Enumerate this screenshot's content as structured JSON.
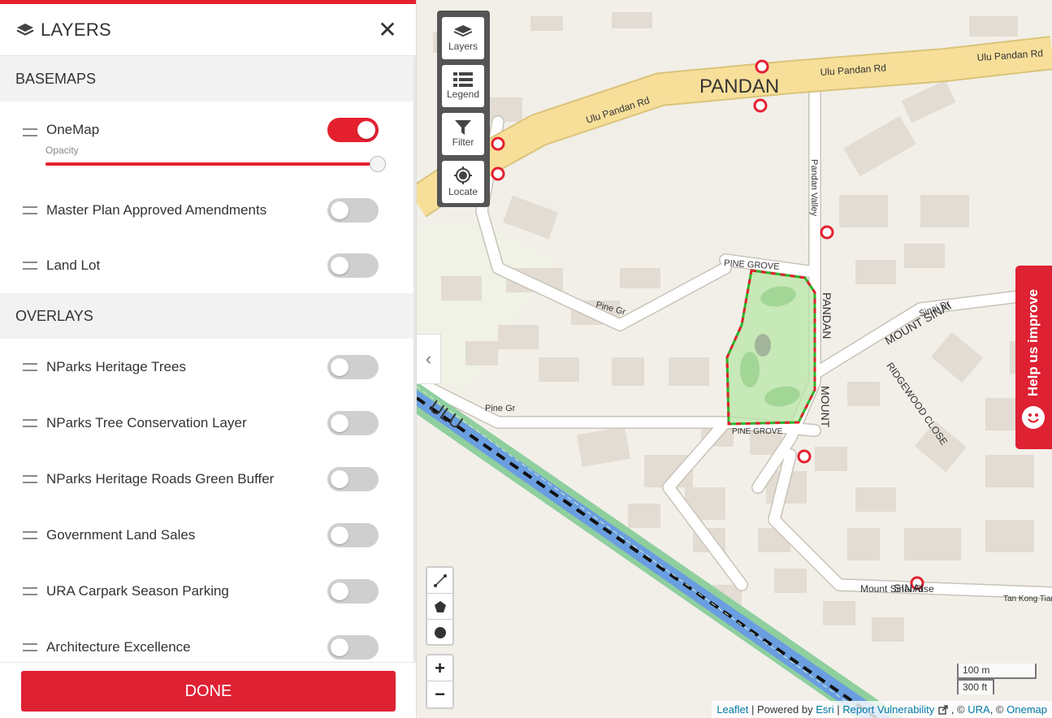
{
  "panel": {
    "title": "LAYERS",
    "close_glyph": "✕",
    "basemaps": {
      "heading": "BASEMAPS",
      "items": [
        {
          "label": "OneMap",
          "enabled": true,
          "opacity_label": "Opacity",
          "opacity": 1.0
        },
        {
          "label": "Master Plan Approved Amendments",
          "enabled": false
        },
        {
          "label": "Land Lot",
          "enabled": false
        }
      ]
    },
    "overlays": {
      "heading": "OVERLAYS",
      "items": [
        {
          "label": "NParks Heritage Trees",
          "enabled": false
        },
        {
          "label": "NParks Tree Conservation Layer",
          "enabled": false
        },
        {
          "label": "NParks Heritage Roads Green Buffer",
          "enabled": false
        },
        {
          "label": "Government Land Sales",
          "enabled": false
        },
        {
          "label": "URA Carpark Season Parking",
          "enabled": false
        },
        {
          "label": "Architecture Excellence",
          "enabled": false
        }
      ]
    },
    "done_label": "DONE",
    "collapse_glyph": "‹"
  },
  "toolbox": {
    "layers": "Layers",
    "legend": "Legend",
    "filter": "Filter",
    "locate": "Locate"
  },
  "zoom": {
    "in": "+",
    "out": "−"
  },
  "scale": {
    "metric": "100 m",
    "imperial": "300 ft"
  },
  "attribution": {
    "leaflet": "Leaflet",
    "sep1": " | Powered by ",
    "esri": "Esri",
    "sep2": " | ",
    "report": "Report Vulnerability",
    "sep3": " , © ",
    "ura": "URA",
    "sep4": ", © ",
    "onemap": "Onemap"
  },
  "help_tab": {
    "label": "Help us improve"
  },
  "map_labels": {
    "pandan": "PANDAN",
    "ulu_pandan_rd_1": "Ulu Pandan Rd",
    "ulu_pandan_rd_2": "Ulu Pandan Rd",
    "ulu_pandan_rd_3": "Ulu Pandan Rd",
    "pine_grove_1": "PINE GROVE",
    "pine_grove_2": "PINE GROVE",
    "pine_gr_1": "Pine Gr",
    "pine_gr_2": "Pine Gr",
    "pandan_valley": "PANDAN",
    "valley": "Pandan Valley",
    "mount_sinai_1": "MOUNT",
    "mount_sinai_2": "MOUNT SINAI",
    "ridgewood_close": "RIDGEWOOD CLOSE",
    "mount_sinai_rise": "Mount Sinai Rise",
    "sinai": "SINAI",
    "ulu": "ULU",
    "tan_kong_tian": "Tan Kong Tian Tp",
    "sinai_dr": "Sinai Dr"
  },
  "colors": {
    "accent": "#e4202f",
    "road_major": "#f7df9a",
    "canal": "#6a9ee0",
    "selection_fill": "#b8e6a5",
    "selection_stroke": "#e4202f"
  }
}
